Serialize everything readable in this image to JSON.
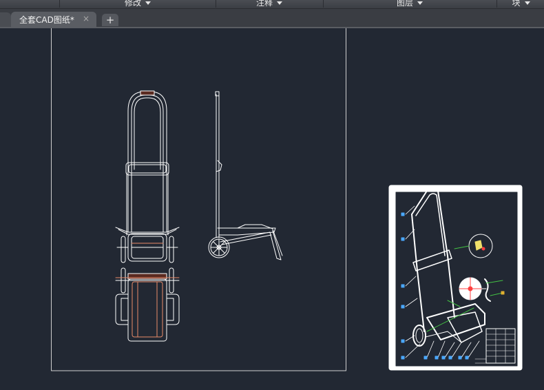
{
  "ribbon": {
    "panels": [
      {
        "label": "修改"
      },
      {
        "label": "注释"
      },
      {
        "label": "图层"
      },
      {
        "label": "块"
      }
    ]
  },
  "tabs": {
    "items": [
      {
        "label": "全套CAD图纸*"
      }
    ],
    "close_glyph": "×",
    "add_glyph": "+"
  },
  "canvas": {
    "background": "#222833",
    "line_color": "#ffffff",
    "accent_colors": {
      "dimension": "#e98c6a",
      "leader": "#44c244",
      "balloon": "#4aa8ff",
      "marker": "#ff4040"
    }
  }
}
